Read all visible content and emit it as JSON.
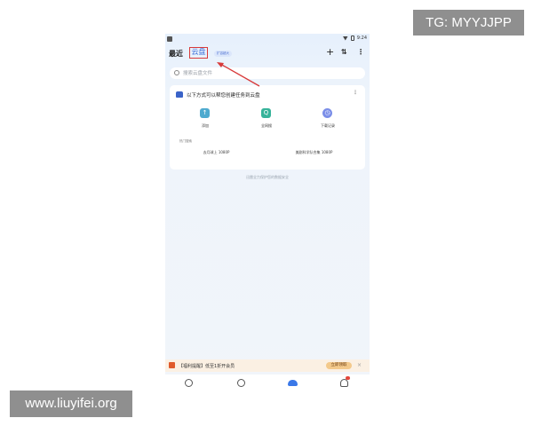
{
  "watermarks": {
    "top_right": "TG: MYYJJPP",
    "bottom_left": "www.liuyifei.org"
  },
  "status_bar": {
    "time": "9:24"
  },
  "header": {
    "tab_recent": "最近",
    "tab_cloud": "云盘",
    "badge": "扩容超大"
  },
  "search": {
    "placeholder": "搜索云盘文件"
  },
  "card": {
    "title": "以下方式可以帮您创建任务到云盘",
    "actions": [
      {
        "label": "添加",
        "icon": "upload-arrow-icon"
      },
      {
        "label": "全网搜",
        "icon": "search-icon"
      },
      {
        "label": "下载记录",
        "icon": "clock-icon"
      }
    ],
    "hot_label": "热门搜索",
    "hot_items": [
      "去月球上 1080P",
      "美剧科学队合集 1080P"
    ]
  },
  "secure_note": "迅雷全力保护您的数据安全",
  "promo": {
    "text": "【福利提醒】低至1折开会员",
    "button": "立即领取"
  },
  "colors": {
    "accent": "#3b6fd8",
    "annotation": "#d83a3a"
  }
}
